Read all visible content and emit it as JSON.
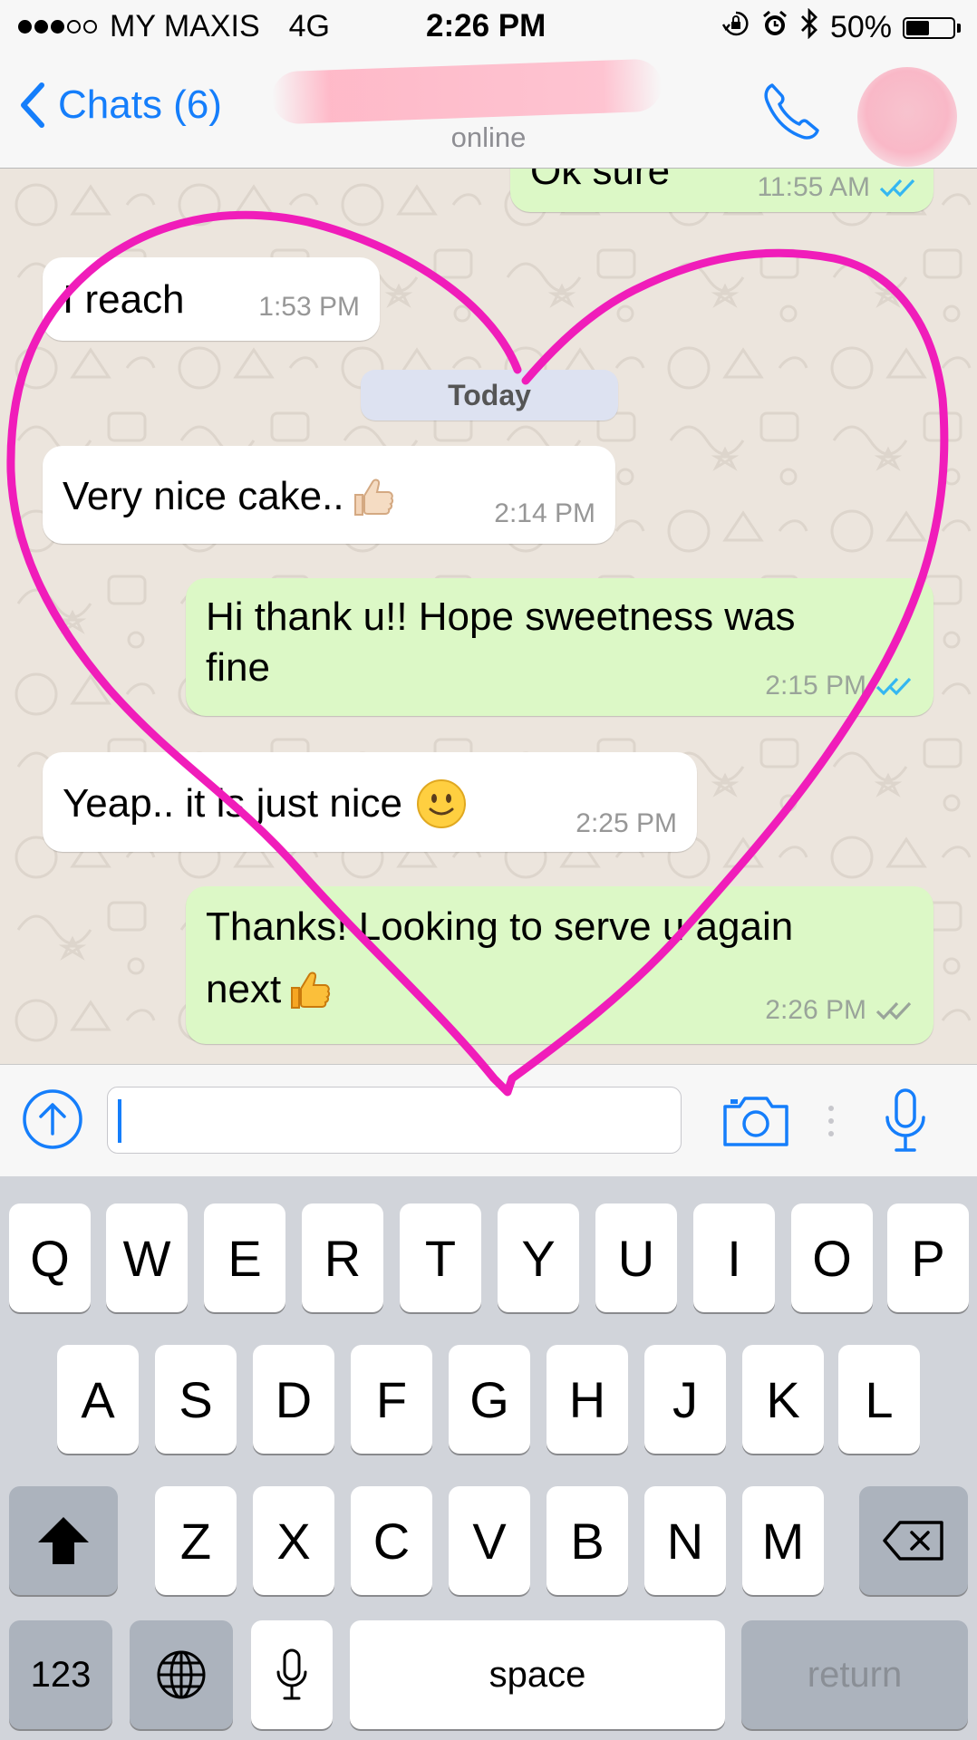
{
  "status_bar": {
    "carrier": "MY MAXIS",
    "network": "4G",
    "time": "2:26 PM",
    "battery_level": "50%",
    "battery_fraction": 0.5,
    "icons": [
      "signal-dots-icon",
      "orientation-lock-icon",
      "alarm-icon",
      "bluetooth-icon",
      "battery-icon"
    ]
  },
  "nav": {
    "back_label": "Chats (6)",
    "contact_status": "online"
  },
  "chat": {
    "date_divider": "Today",
    "messages": [
      {
        "dir": "out",
        "text": "Ok sure",
        "time": "11:55 AM",
        "ticks": "read"
      },
      {
        "dir": "in",
        "text": "I reach",
        "time": "1:53 PM"
      },
      {
        "dir": "in",
        "text": "Very nice cake..",
        "emoji": "thumbs-up-light-icon",
        "time": "2:14 PM"
      },
      {
        "dir": "out",
        "text_line1": "Hi thank u!! Hope sweetness was",
        "text_line2": "fine",
        "time": "2:15 PM",
        "ticks": "read"
      },
      {
        "dir": "in",
        "text": "Yeap.. it is just nice",
        "emoji": "slightly-smiling-face-icon",
        "time": "2:25 PM"
      },
      {
        "dir": "out",
        "text_line1": "Thanks! Looking to serve u again",
        "text_line2": "next",
        "emoji": "thumbs-up-icon",
        "time": "2:26 PM",
        "ticks": "delivered"
      }
    ]
  },
  "input_bar": {
    "placeholder": "",
    "icons": [
      "upload-icon",
      "camera-icon",
      "microphone-icon"
    ]
  },
  "keyboard": {
    "row1": [
      "Q",
      "W",
      "E",
      "R",
      "T",
      "Y",
      "U",
      "I",
      "O",
      "P"
    ],
    "row2": [
      "A",
      "S",
      "D",
      "F",
      "G",
      "H",
      "J",
      "K",
      "L"
    ],
    "row3": [
      "Z",
      "X",
      "C",
      "V",
      "B",
      "N",
      "M"
    ],
    "numbers_label": "123",
    "space_label": "space",
    "return_label": "return"
  },
  "colors": {
    "accent": "#157efb",
    "outgoing_bubble": "#dcf8c6",
    "incoming_bubble": "#ffffff",
    "chat_background": "#ece5dd",
    "heart_stroke": "#f01dba",
    "read_tick": "#34b7f1"
  }
}
